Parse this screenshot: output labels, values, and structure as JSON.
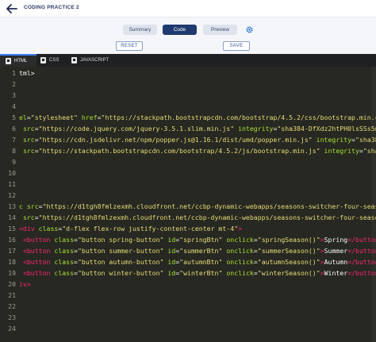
{
  "header": {
    "back_icon": "arrow-left-icon",
    "title": "CODING PRACTICE 2"
  },
  "view_tabs": {
    "summary": "Summary",
    "code": "Code",
    "preview": "Preview",
    "settings_icon": "gear-icon"
  },
  "actions": {
    "reset": "RESET",
    "save": "SAVE"
  },
  "editor_tabs": {
    "html": "HTML",
    "css": "CSS",
    "javascript": "JAVASCRIPT"
  },
  "colors": {
    "active_tab": "#1f3a6e",
    "editor_bg": "#272822",
    "tag": "#f92672",
    "attribute": "#a6e22e",
    "string": "#e6db74",
    "accent": "#3b82f6"
  },
  "code_lines": [
    {
      "n": "1",
      "parts": [
        [
          "txt",
          "tml>"
        ]
      ]
    },
    {
      "n": "2",
      "parts": []
    },
    {
      "n": "3",
      "parts": []
    },
    {
      "n": "4",
      "parts": []
    },
    {
      "n": "5",
      "parts": [
        [
          "attr",
          "el"
        ],
        [
          "txt",
          "="
        ],
        [
          "str",
          "\"stylesheet\""
        ],
        [
          "txt",
          " "
        ],
        [
          "attr",
          "href"
        ],
        [
          "txt",
          "="
        ],
        [
          "str",
          "\"https://stackpath.bootstrapcdn.com/bootstrap/4.5.2/css/bootstrap.min.css\""
        ],
        [
          "txt",
          " "
        ],
        [
          "attr",
          "in"
        ]
      ]
    },
    {
      "n": "6",
      "parts": [
        [
          "txt",
          " "
        ],
        [
          "attr",
          "src"
        ],
        [
          "txt",
          "="
        ],
        [
          "str",
          "\"https://code.jquery.com/jquery-3.5.1.slim.min.js\""
        ],
        [
          "txt",
          " "
        ],
        [
          "attr",
          "integrity"
        ],
        [
          "txt",
          "="
        ],
        [
          "str",
          "\"sha384-DfXdz2htPH0lsSSs5nCTpu"
        ]
      ]
    },
    {
      "n": "7",
      "parts": [
        [
          "txt",
          " "
        ],
        [
          "attr",
          "src"
        ],
        [
          "txt",
          "="
        ],
        [
          "str",
          "\"https://cdn.jsdelivr.net/npm/popper.js@1.16.1/dist/umd/popper.min.js\""
        ],
        [
          "txt",
          " "
        ],
        [
          "attr",
          "integrity"
        ],
        [
          "txt",
          "="
        ],
        [
          "str",
          "\"sha384-9/re"
        ]
      ]
    },
    {
      "n": "8",
      "parts": [
        [
          "txt",
          " "
        ],
        [
          "attr",
          "src"
        ],
        [
          "txt",
          "="
        ],
        [
          "str",
          "\"https://stackpath.bootstrapcdn.com/bootstrap/4.5.2/js/bootstrap.min.js\""
        ],
        [
          "txt",
          " "
        ],
        [
          "attr",
          "integrity"
        ],
        [
          "txt",
          "="
        ],
        [
          "str",
          "\"sha384-B"
        ]
      ]
    },
    {
      "n": "9",
      "parts": []
    },
    {
      "n": "10",
      "parts": []
    },
    {
      "n": "11",
      "parts": []
    },
    {
      "n": "12",
      "parts": []
    },
    {
      "n": "13",
      "parts": [
        [
          "attr",
          "c"
        ],
        [
          "txt",
          " "
        ],
        [
          "attr",
          "src"
        ],
        [
          "txt",
          "="
        ],
        [
          "str",
          "\"https://d1tgh8fmlzexmh.cloudfront.net/ccbp-dynamic-webapps/seasons-switcher-four-seasons-x"
        ]
      ]
    },
    {
      "n": "14",
      "parts": [
        [
          "txt",
          " "
        ],
        [
          "attr",
          "src"
        ],
        [
          "txt",
          "="
        ],
        [
          "str",
          "\"https://d1tgh8fmlzexmh.cloudfront.net/ccbp-dynamic-webapps/seasons-switcher-four-seasons-x"
        ]
      ]
    },
    {
      "n": "15",
      "parts": [
        [
          "tag",
          "<div"
        ],
        [
          "txt",
          " "
        ],
        [
          "attr",
          "class"
        ],
        [
          "txt",
          "="
        ],
        [
          "str",
          "\"d-flex flex-row justify-content-center mt-4\""
        ],
        [
          "tag",
          ">"
        ]
      ]
    },
    {
      "n": "16",
      "parts": [
        [
          "txt",
          " "
        ],
        [
          "tag",
          "<button"
        ],
        [
          "txt",
          " "
        ],
        [
          "attr",
          "class"
        ],
        [
          "txt",
          "="
        ],
        [
          "str",
          "\"button spring-button\""
        ],
        [
          "txt",
          " "
        ],
        [
          "attr",
          "id"
        ],
        [
          "txt",
          "="
        ],
        [
          "str",
          "\"springBtn\""
        ],
        [
          "txt",
          " "
        ],
        [
          "attr",
          "onclick"
        ],
        [
          "txt",
          "="
        ],
        [
          "str",
          "\"springSeason()\""
        ],
        [
          "tag",
          ">"
        ],
        [
          "txt",
          "Spring"
        ],
        [
          "tag",
          "</button>"
        ]
      ]
    },
    {
      "n": "17",
      "parts": [
        [
          "txt",
          " "
        ],
        [
          "tag",
          "<button"
        ],
        [
          "txt",
          " "
        ],
        [
          "attr",
          "class"
        ],
        [
          "txt",
          "="
        ],
        [
          "str",
          "\"button summer-button\""
        ],
        [
          "txt",
          " "
        ],
        [
          "attr",
          "id"
        ],
        [
          "txt",
          "="
        ],
        [
          "str",
          "\"summerBtn\""
        ],
        [
          "txt",
          " "
        ],
        [
          "attr",
          "onclick"
        ],
        [
          "txt",
          "="
        ],
        [
          "str",
          "\"summerSeason()\""
        ],
        [
          "tag",
          ">"
        ],
        [
          "txt",
          "Summer"
        ],
        [
          "tag",
          "</button>"
        ]
      ]
    },
    {
      "n": "18",
      "parts": [
        [
          "txt",
          " "
        ],
        [
          "tag",
          "<button"
        ],
        [
          "txt",
          " "
        ],
        [
          "attr",
          "class"
        ],
        [
          "txt",
          "="
        ],
        [
          "str",
          "\"button autumn-button\""
        ],
        [
          "txt",
          " "
        ],
        [
          "attr",
          "id"
        ],
        [
          "txt",
          "="
        ],
        [
          "str",
          "\"autumnBtn\""
        ],
        [
          "txt",
          " "
        ],
        [
          "attr",
          "onclick"
        ],
        [
          "txt",
          "="
        ],
        [
          "str",
          "\"autumnSeason()\""
        ],
        [
          "tag",
          ">"
        ],
        [
          "txt",
          "Autumn"
        ],
        [
          "tag",
          "</button>"
        ]
      ]
    },
    {
      "n": "19",
      "parts": [
        [
          "txt",
          " "
        ],
        [
          "tag",
          "<button"
        ],
        [
          "txt",
          " "
        ],
        [
          "attr",
          "class"
        ],
        [
          "txt",
          "="
        ],
        [
          "str",
          "\"button winter-button\""
        ],
        [
          "txt",
          " "
        ],
        [
          "attr",
          "id"
        ],
        [
          "txt",
          "="
        ],
        [
          "str",
          "\"winterBtn\""
        ],
        [
          "txt",
          " "
        ],
        [
          "attr",
          "onclick"
        ],
        [
          "txt",
          "="
        ],
        [
          "str",
          "\"winterSeason()\""
        ],
        [
          "tag",
          ">"
        ],
        [
          "txt",
          "Winter"
        ],
        [
          "tag",
          "</button>"
        ]
      ]
    },
    {
      "n": "20",
      "parts": [
        [
          "tag",
          "iv>"
        ]
      ]
    },
    {
      "n": "21",
      "parts": []
    },
    {
      "n": "22",
      "parts": []
    },
    {
      "n": "23",
      "parts": []
    },
    {
      "n": "24",
      "parts": []
    }
  ]
}
